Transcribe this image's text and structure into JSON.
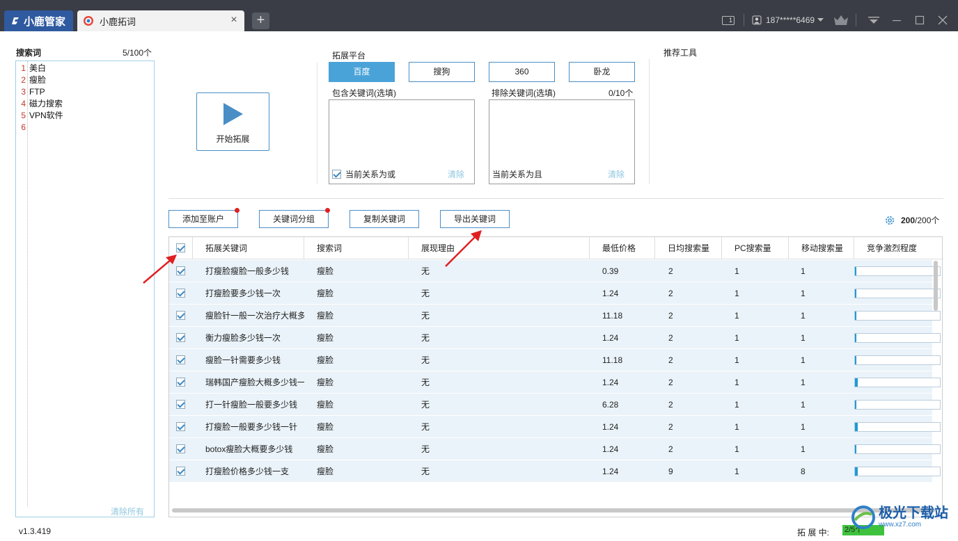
{
  "titlebar": {
    "brand": "小鹿管家",
    "tab_title": "小鹿拓词",
    "tab_close": "×",
    "new_tab": "+",
    "window_badge": "1",
    "user": "187*****6469"
  },
  "search_words": {
    "title": "搜索词",
    "count": "5/100个",
    "lines": [
      {
        "num": "1",
        "text": "美白"
      },
      {
        "num": "2",
        "text": "瘦脸"
      },
      {
        "num": "3",
        "text": "FTP"
      },
      {
        "num": "4",
        "text": "磁力搜索"
      },
      {
        "num": "5",
        "text": "VPN软件"
      },
      {
        "num": "6",
        "text": ""
      }
    ],
    "clear_all": "清除所有"
  },
  "start_button": "开始拓展",
  "platform": {
    "label": "拓展平台",
    "options": [
      "百度",
      "搜狗",
      "360",
      "卧龙"
    ],
    "selected": "百度"
  },
  "include": {
    "label": "包含关键词(选填)",
    "relation": "当前关系为或",
    "clear": "清除"
  },
  "exclude": {
    "label": "排除关键词(选填)",
    "count": "0/10个",
    "relation": "当前关系为且",
    "clear": "清除"
  },
  "recommend_tools": "推荐工具",
  "actions": {
    "add_account": "添加至账户",
    "group": "关键词分组",
    "copy": "复制关键词",
    "export": "导出关键词"
  },
  "total": {
    "bold": "200",
    "rest": "/200个"
  },
  "table": {
    "columns": [
      "拓展关键词",
      "搜索词",
      "展现理由",
      "最低价格",
      "日均搜索量",
      "PC搜索量",
      "移动搜索量",
      "竞争激烈程度"
    ],
    "rows": [
      {
        "keyword": "打瘦脸瘦脸一般多少钱",
        "search": "瘦脸",
        "reason": "无",
        "price": "0.39",
        "daily": "2",
        "pc": "1",
        "mobile": "1",
        "competition": 0.01
      },
      {
        "keyword": "打瘦脸要多少钱一次",
        "search": "瘦脸",
        "reason": "无",
        "price": "1.24",
        "daily": "2",
        "pc": "1",
        "mobile": "1",
        "competition": 0.01
      },
      {
        "keyword": "瘦脸针一般一次治疗大概多",
        "search": "瘦脸",
        "reason": "无",
        "price": "11.18",
        "daily": "2",
        "pc": "1",
        "mobile": "1",
        "competition": 0.01
      },
      {
        "keyword": "衡力瘦脸多少钱一次",
        "search": "瘦脸",
        "reason": "无",
        "price": "1.24",
        "daily": "2",
        "pc": "1",
        "mobile": "1",
        "competition": 0.01
      },
      {
        "keyword": "瘦脸一针需要多少钱",
        "search": "瘦脸",
        "reason": "无",
        "price": "11.18",
        "daily": "2",
        "pc": "1",
        "mobile": "1",
        "competition": 0.01
      },
      {
        "keyword": "瑞韩国产瘦脸大概多少钱一",
        "search": "瘦脸",
        "reason": "无",
        "price": "1.24",
        "daily": "2",
        "pc": "1",
        "mobile": "1",
        "competition": 0.03
      },
      {
        "keyword": "打一针瘦脸一般要多少钱",
        "search": "瘦脸",
        "reason": "无",
        "price": "6.28",
        "daily": "2",
        "pc": "1",
        "mobile": "1",
        "competition": 0.01
      },
      {
        "keyword": "打瘦脸一般要多少钱一针",
        "search": "瘦脸",
        "reason": "无",
        "price": "1.24",
        "daily": "2",
        "pc": "1",
        "mobile": "1",
        "competition": 0.03
      },
      {
        "keyword": "botox瘦脸大概要多少钱",
        "search": "瘦脸",
        "reason": "无",
        "price": "1.24",
        "daily": "2",
        "pc": "1",
        "mobile": "1",
        "competition": 0.01
      },
      {
        "keyword": "打瘦脸价格多少钱一支",
        "search": "瘦脸",
        "reason": "无",
        "price": "1.24",
        "daily": "9",
        "pc": "1",
        "mobile": "8",
        "competition": 0.03
      }
    ]
  },
  "footer": {
    "version": "v1.3.419",
    "status_label": "拓 展 中:",
    "status_progress": "2/5个"
  },
  "watermark": {
    "main": "极光下载站",
    "sub": "www.xz7.com"
  },
  "colors": {
    "accent": "#4a8ec6",
    "active": "#4aa3d8",
    "bar": "#1f9ad6",
    "row_bg": "#eaf3f9",
    "arrow": "#e02020"
  }
}
